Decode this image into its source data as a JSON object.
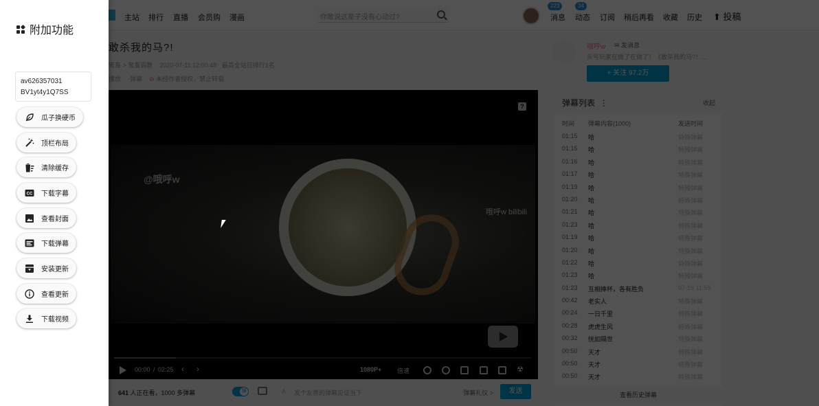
{
  "side_panel": {
    "title": "附加功能",
    "av_id": "av626357031",
    "bv_id": "BV1yt4y1Q7SS",
    "buttons": [
      {
        "label": "瓜子换硬币",
        "icon": "leaf-icon"
      },
      {
        "label": "顶栏布局",
        "icon": "magic-wand-icon"
      },
      {
        "label": "清除缓存",
        "icon": "clear-cache-icon"
      },
      {
        "label": "下载字幕",
        "icon": "subtitles-icon"
      },
      {
        "label": "查看封面",
        "icon": "image-icon"
      },
      {
        "label": "下载弹幕",
        "icon": "danmaku-icon"
      },
      {
        "label": "安装更新",
        "icon": "archive-icon"
      },
      {
        "label": "查看更新",
        "icon": "info-icon"
      },
      {
        "label": "下载视频",
        "icon": "download-icon"
      }
    ]
  },
  "nav": {
    "left": [
      "主站",
      "排行",
      "直播",
      "会员购",
      "漫画"
    ],
    "search_placeholder": "你敢说这辈子没有心动过?",
    "right": [
      "消息",
      "动态",
      "订阅",
      "稍后再看",
      "收藏",
      "历史"
    ],
    "badges": {
      "messages": "223",
      "dynamic": "34"
    },
    "upload": "投稿"
  },
  "video": {
    "title": "敢杀我的马?!",
    "category": "鬼畜 > 鬼畜调教",
    "date": "2020-07-11 12:00:48",
    "rank": "最高全站日排行1名",
    "plays": "播放",
    "danmaku_count_meta": "·弹幕",
    "copyright": "未经作者授权，禁止转载",
    "watermark_left": "@哦呼w",
    "watermark_right": "哦呼w bilibili",
    "time_current": "00:00",
    "time_sep": "/",
    "time_total": "02:25",
    "quality": "1080P+",
    "speed": "倍速"
  },
  "bottom": {
    "viewers_num": "641",
    "viewers_text": " 人正在看，",
    "danmaku_text": "1000 多弹幕",
    "input_placeholder": "发个友善的弹幕见证当下",
    "etiquette": "弹幕礼仪 >",
    "send": "发送"
  },
  "uploader": {
    "name": "哦呼w",
    "message": "发消息",
    "desc": "头号玩家在做了在做了！《敢杀我的马?！...",
    "follow": "+  关注 97.2万"
  },
  "danmaku_panel": {
    "title": "弹幕列表",
    "collapse": "收起",
    "col_time": "时间",
    "col_content": "弹幕内容(1000)",
    "col_sent": "发送时间",
    "footer": "查看历史弹幕",
    "rows": [
      {
        "time": "01:15",
        "content": "哈",
        "sent": "特殊弹幕"
      },
      {
        "time": "01:15",
        "content": "哈",
        "sent": "特殊弹幕"
      },
      {
        "time": "01:16",
        "content": "哈",
        "sent": "特殊弹幕"
      },
      {
        "time": "01:17",
        "content": "哈",
        "sent": "特殊弹幕"
      },
      {
        "time": "01:19",
        "content": "哈",
        "sent": "特殊弹幕"
      },
      {
        "time": "01:20",
        "content": "哈",
        "sent": "特殊弹幕"
      },
      {
        "time": "01:21",
        "content": "哈",
        "sent": "特殊弹幕"
      },
      {
        "time": "01:23",
        "content": "哈",
        "sent": "特殊弹幕"
      },
      {
        "time": "01:19",
        "content": "哈",
        "sent": "特殊弹幕"
      },
      {
        "time": "01:20",
        "content": "哈",
        "sent": "特殊弹幕"
      },
      {
        "time": "01:22",
        "content": "哈",
        "sent": "特殊弹幕"
      },
      {
        "time": "01:23",
        "content": "哈",
        "sent": "特殊弹幕"
      },
      {
        "time": "01:23",
        "content": "互相捧杯，各有胜负",
        "sent": "07-16 11:59"
      },
      {
        "time": "00:42",
        "content": "老实人",
        "sent": "特殊弹幕"
      },
      {
        "time": "00:24",
        "content": "一日千里",
        "sent": "特殊弹幕"
      },
      {
        "time": "00:28",
        "content": "虎虎生风",
        "sent": "特殊弹幕"
      },
      {
        "time": "00:32",
        "content": "恍如隔世",
        "sent": "特殊弹幕"
      },
      {
        "time": "00:50",
        "content": "天才",
        "sent": "特殊弹幕"
      },
      {
        "time": "00:50",
        "content": "天才",
        "sent": "特殊弹幕"
      },
      {
        "time": "00:50",
        "content": "天才",
        "sent": "特殊弹幕"
      }
    ]
  },
  "colors": {
    "accent": "#00a1d6",
    "pink": "#fb7299",
    "overlay": "#000000"
  }
}
